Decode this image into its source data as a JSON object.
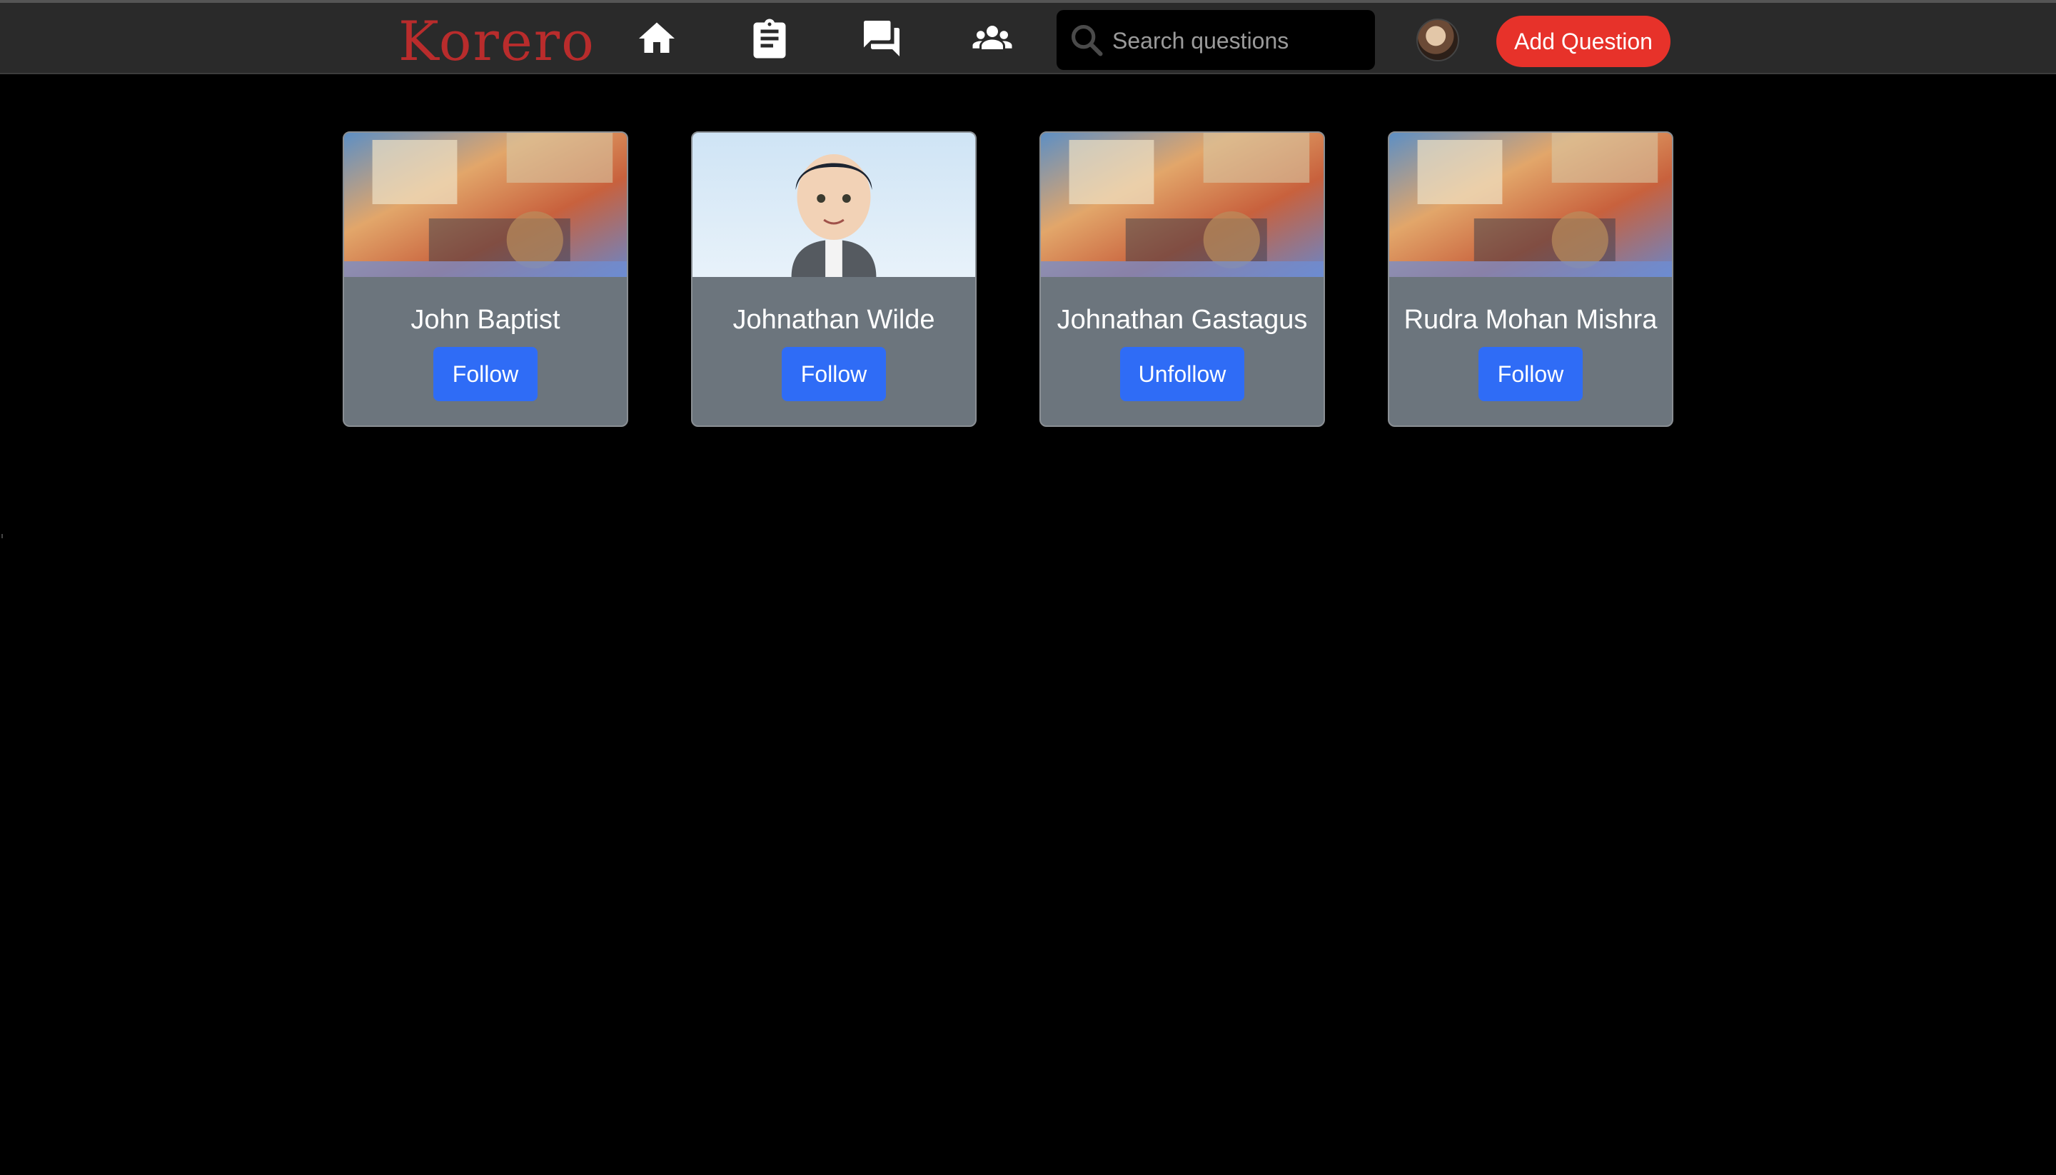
{
  "header": {
    "logo": "Korero",
    "nav": [
      {
        "name": "home-icon"
      },
      {
        "name": "clipboard-icon"
      },
      {
        "name": "chat-icon"
      },
      {
        "name": "people-icon"
      }
    ],
    "search": {
      "placeholder": "Search questions",
      "value": ""
    },
    "add_question_label": "Add Question"
  },
  "cards": [
    {
      "name": "John Baptist",
      "button": "Follow",
      "image": "painting-cover"
    },
    {
      "name": "Johnathan Wilde",
      "button": "Follow",
      "image": "cartoon-avatar"
    },
    {
      "name": "Johnathan Gastagus",
      "button": "Unfollow",
      "image": "painting-cover"
    },
    {
      "name": "Rudra Mohan Mishra",
      "button": "Follow",
      "image": "painting-cover"
    }
  ],
  "colors": {
    "brand": "#b92c2c",
    "accent": "#e7322a",
    "button": "#2f6cf6",
    "card": "#6c757d",
    "header": "#2a2a2a",
    "background": "#000000"
  }
}
